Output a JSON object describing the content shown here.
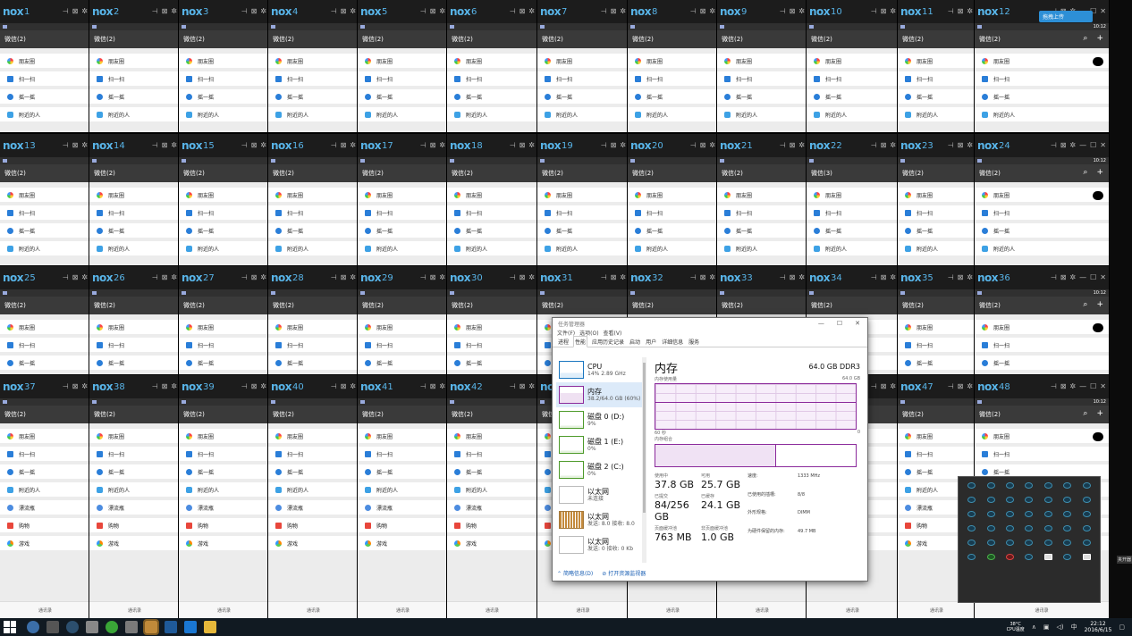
{
  "nox_logo": "nox",
  "wechat_title": "微信(2)",
  "wechat_title_alt": "微信(3)",
  "items": {
    "moments": "朋友圈",
    "scan": "扫一扫",
    "shake": "摇一摇",
    "nearby": "附近的人",
    "bottle": "漂流瓶",
    "shop": "购物",
    "game": "游戏"
  },
  "bottom_nav": [
    "微信",
    "通讯录",
    "发现"
  ],
  "upload_button": "拖拽上传",
  "statusbar_time": "10:12",
  "task_manager": {
    "title": "任务管理器",
    "menu": [
      "文件(F)",
      "选项(O)",
      "查看(V)"
    ],
    "tabs": [
      "进程",
      "性能",
      "应用历史记录",
      "启动",
      "用户",
      "详细信息",
      "服务"
    ],
    "active_tab": "性能",
    "sidebar": [
      {
        "name": "CPU",
        "sub": "14% 2.89 GHz",
        "kind": "cpu"
      },
      {
        "name": "内存",
        "sub": "38.2/64.0 GB (60%)",
        "kind": "mem",
        "selected": true
      },
      {
        "name": "磁盘 0 (D:)",
        "sub": "9%",
        "kind": "disk"
      },
      {
        "name": "磁盘 1 (E:)",
        "sub": "0%",
        "kind": "disk"
      },
      {
        "name": "磁盘 2 (C:)",
        "sub": "0%",
        "kind": "disk"
      },
      {
        "name": "以太网",
        "sub": "未连接",
        "kind": "net0"
      },
      {
        "name": "以太网",
        "sub": "发送: 8.0 接收: 8.0",
        "kind": "net"
      },
      {
        "name": "以太网",
        "sub": "发送: 0 接收: 0 Kb",
        "kind": "net0"
      }
    ],
    "heading": "内存",
    "spec": "64.0 GB DDR3",
    "usage_label": "内存使用量",
    "usage_max": "64.0 GB",
    "axis_left": "60 秒",
    "axis_right": "0",
    "composition_label": "内存组合",
    "stats": [
      {
        "k": "使用中",
        "v": "37.8 GB"
      },
      {
        "k": "可用",
        "v": "25.7 GB"
      },
      {
        "k": "已提交",
        "v": "84/256 GB"
      },
      {
        "k": "已缓存",
        "v": "24.1 GB"
      },
      {
        "k": "页面缓冲池",
        "v": "763 MB"
      },
      {
        "k": "非页面缓冲池",
        "v": "1.0 GB"
      }
    ],
    "specs": [
      {
        "k": "速度:",
        "v": "1333 MHz"
      },
      {
        "k": "已使用的插槽:",
        "v": "8/8"
      },
      {
        "k": "外形规格:",
        "v": "DIMM"
      },
      {
        "k": "为硬件保留的内存:",
        "v": "49.7 MB"
      }
    ],
    "footer_brief": "简略信息(D)",
    "footer_monitor": "打开资源监视器"
  },
  "taskbar": {
    "temp": "38°C",
    "cpu_label": "CPU温度",
    "ime": "中",
    "time": "22:12",
    "date": "2016/6/15"
  },
  "edge_text": [
    "夹开器"
  ]
}
